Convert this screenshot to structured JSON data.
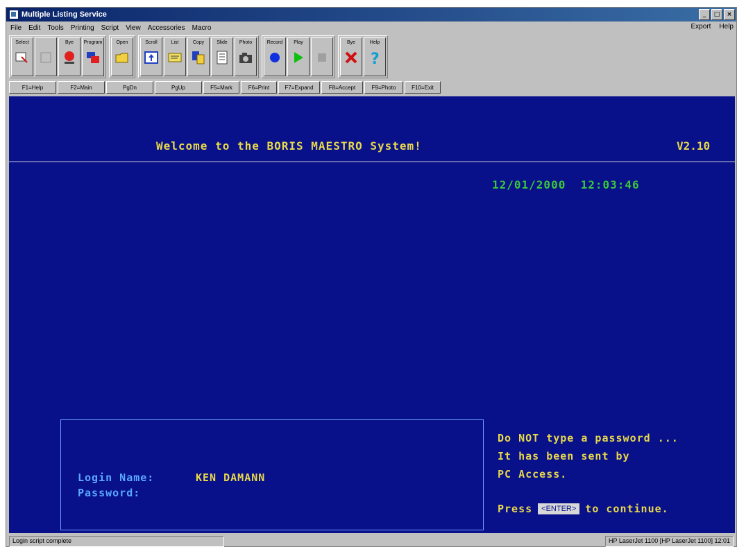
{
  "window": {
    "title": "Multiple Listing Service",
    "controls": [
      "_",
      "□",
      "×"
    ]
  },
  "menu": {
    "items": [
      "File",
      "Edit",
      "Tools",
      "Printing",
      "Script",
      "View",
      "Accessories",
      "Macro"
    ],
    "right_items": [
      "Export",
      "Help"
    ]
  },
  "toolbar": {
    "buttons": [
      {
        "label": "Select",
        "icon": "select-icon"
      },
      {
        "label": "",
        "icon": "blank-icon"
      },
      {
        "label": "Bye",
        "icon": "stop-sign-icon"
      },
      {
        "label": "Program",
        "icon": "program-icon"
      },
      {
        "label": "Open",
        "icon": "open-folder-icon"
      },
      {
        "label": "Scroll",
        "icon": "scroll-icon"
      },
      {
        "label": "List",
        "icon": "list-icon"
      },
      {
        "label": "Copy",
        "icon": "copy-icon"
      },
      {
        "label": "Slide",
        "icon": "slide-icon"
      },
      {
        "label": "Photo",
        "icon": "camera-icon"
      },
      {
        "label": "Record",
        "icon": "record-icon"
      },
      {
        "label": "Play",
        "icon": "play-icon"
      },
      {
        "label": "",
        "icon": "stop-icon"
      },
      {
        "label": "Bye",
        "icon": "exit-x-icon"
      },
      {
        "label": "Help",
        "icon": "help-icon"
      }
    ],
    "colors": {
      "record": "#1030e0",
      "play": "#10c010",
      "exit": "#d01010",
      "help": "#10a0d0",
      "folder": "#f0d040"
    }
  },
  "fkeys": [
    "F1=Help",
    "F2=Main",
    "PgDn",
    "PgUp",
    "F5=Mark",
    "F6=Print",
    "F7=Expand",
    "F8=Accept",
    "F9=Photo",
    "F10=Exit"
  ],
  "terminal": {
    "welcome": "Welcome to the BORIS MAESTRO System!",
    "version": "V2.10",
    "date": "12/01/2000",
    "time": "12:03:46",
    "login_name_label": "Login Name:",
    "login_name_value": "KEN DAMANN",
    "password_label": "Password:",
    "note_line1": "Do NOT type a password ...",
    "note_line2": "It has been sent by",
    "note_line3": "PC Access.",
    "press_label": "Press",
    "enter_button": "<ENTER>",
    "continue_label": "to continue.",
    "colors": {
      "background": "#08108a",
      "yellow": "#e8d84a",
      "green": "#3ac83a",
      "blue": "#5aa8ff"
    }
  },
  "status": {
    "left": "Login script complete",
    "right": "HP LaserJet 1100 [HP LaserJet 1100] 12:01"
  }
}
